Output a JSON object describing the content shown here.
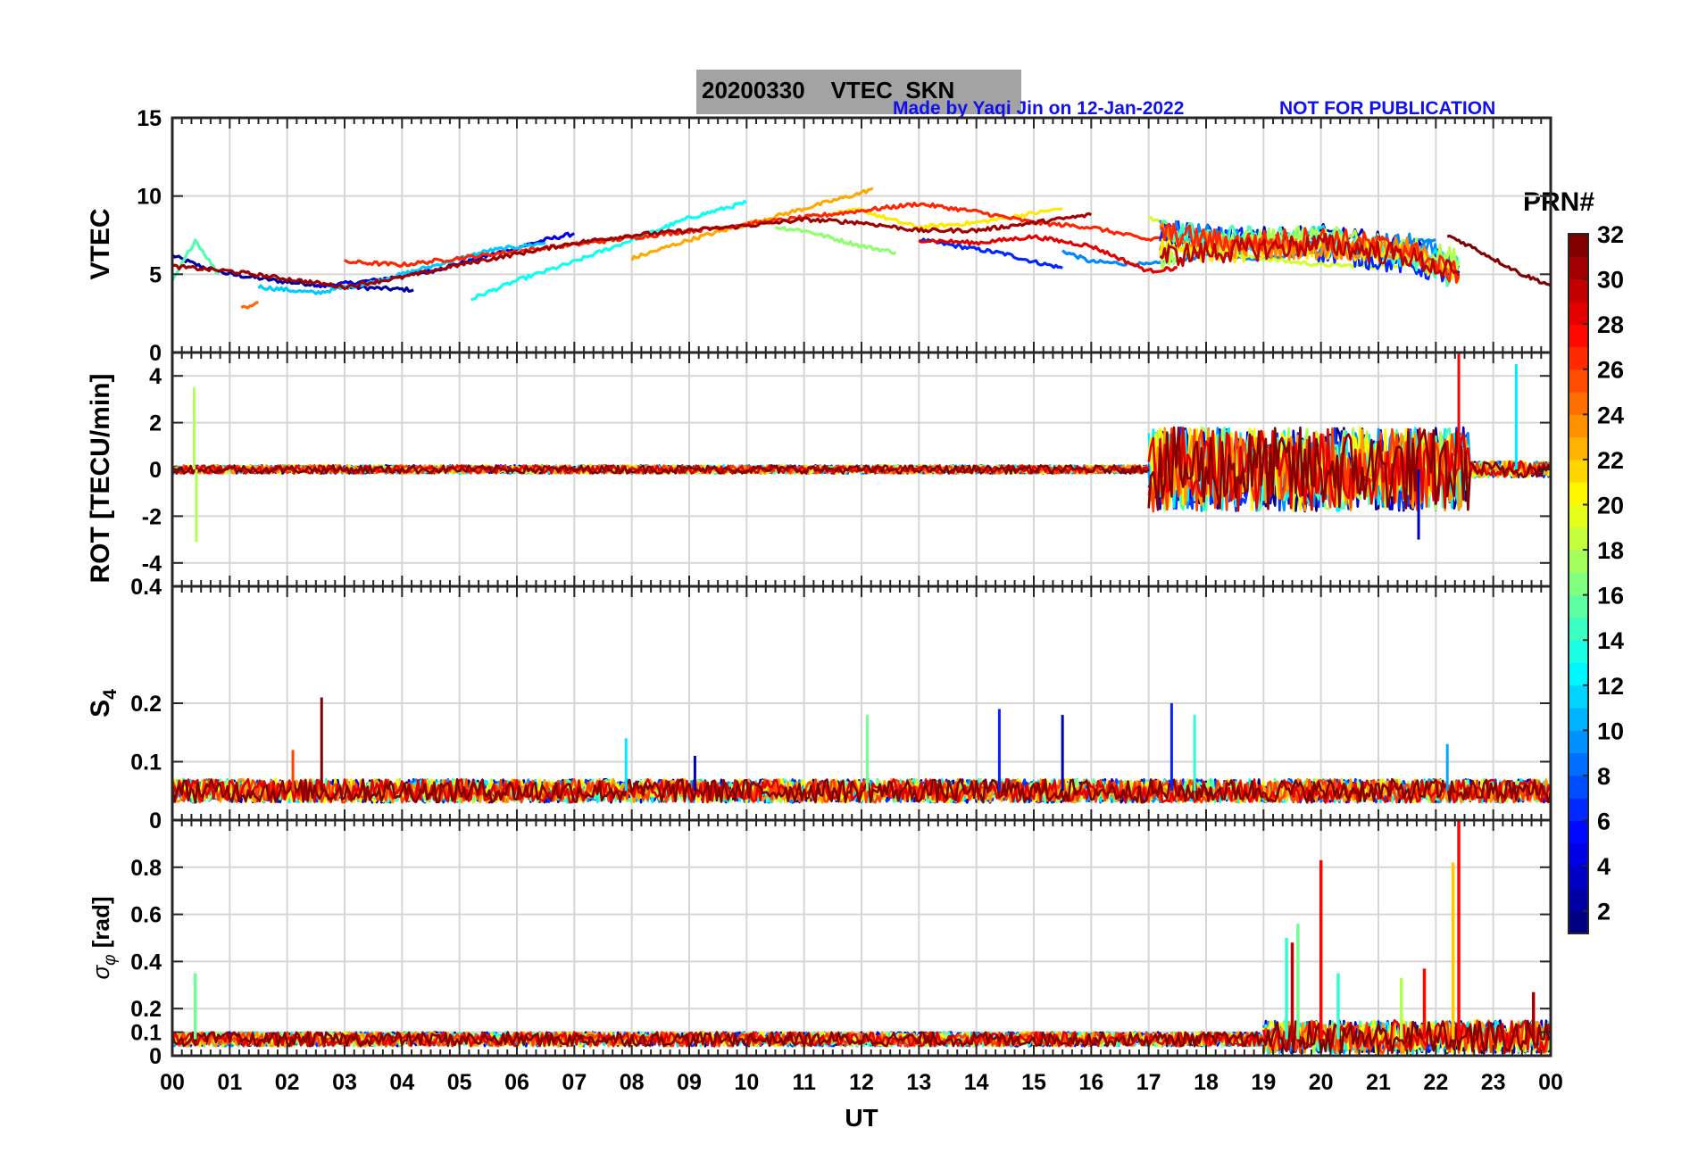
{
  "header": {
    "title": "20200330    VTEC  SKN",
    "credit": "Made by Yaqi Jin on 12-Jan-2022",
    "notice": "NOT FOR PUBLICATION"
  },
  "colorbar": {
    "title": "PRN#",
    "ticks": [
      "2",
      "4",
      "6",
      "8",
      "10",
      "12",
      "14",
      "16",
      "18",
      "20",
      "22",
      "24",
      "26",
      "28",
      "30",
      "32"
    ],
    "min": 1,
    "max": 32,
    "colormap": "jet"
  },
  "chart_data": [
    {
      "type": "line",
      "panel": "vtec",
      "ylabel": "VTEC",
      "ylim": [
        0,
        15
      ],
      "yticks": [
        "0",
        "5",
        "10",
        "15"
      ],
      "xlim": [
        0,
        24
      ],
      "grid": true,
      "series": [
        {
          "prn": 2,
          "x": [
            0,
            0.5,
            1,
            2,
            3,
            4.2
          ],
          "y": [
            6.2,
            5.5,
            5.0,
            4.5,
            4.2,
            4.0
          ]
        },
        {
          "prn": 4,
          "x": [
            2.5,
            3.5,
            4.5,
            5.5,
            6.5,
            7
          ],
          "y": [
            4.2,
            4.6,
            5.2,
            6.2,
            7.2,
            7.6
          ]
        },
        {
          "prn": 6,
          "x": [
            13,
            14,
            14.5,
            15,
            15.5
          ],
          "y": [
            7.2,
            6.6,
            6.3,
            5.8,
            5.4
          ]
        },
        {
          "prn": 9,
          "x": [
            15.5,
            16,
            17,
            18,
            19,
            20,
            21,
            22
          ],
          "y": [
            6.5,
            5.8,
            5.6,
            6.2,
            6.0,
            6.5,
            6.8,
            7.2
          ]
        },
        {
          "prn": 11,
          "x": [
            1.5,
            2.5,
            3.5,
            4.5,
            5.5,
            6.5
          ],
          "y": [
            4.2,
            3.8,
            4.5,
            5.5,
            6.5,
            7.0
          ]
        },
        {
          "prn": 13,
          "x": [
            5.2,
            6,
            7,
            8,
            9,
            10
          ],
          "y": [
            3.4,
            4.6,
            5.8,
            7.2,
            8.6,
            9.6
          ]
        },
        {
          "prn": 15,
          "x": [
            0,
            0.4,
            0.8
          ],
          "y": [
            4.5,
            7.2,
            5.0
          ]
        },
        {
          "prn": 17,
          "x": [
            10.5,
            11,
            11.5,
            12,
            12.6
          ],
          "y": [
            8.0,
            7.8,
            7.3,
            6.8,
            6.4
          ]
        },
        {
          "prn": 19,
          "x": [
            17,
            17.5,
            18,
            19,
            20,
            21,
            22
          ],
          "y": [
            8.6,
            8.0,
            6.4,
            6.0,
            5.6,
            5.5,
            5.8
          ]
        },
        {
          "prn": 21,
          "x": [
            11.5,
            12,
            12.5,
            13,
            14,
            15,
            15.5
          ],
          "y": [
            8.9,
            9.1,
            8.5,
            8.0,
            8.3,
            8.9,
            9.2
          ]
        },
        {
          "prn": 23,
          "x": [
            8,
            9,
            10,
            11,
            12,
            12.2
          ],
          "y": [
            6.0,
            7.2,
            8.2,
            9.2,
            10.2,
            10.5
          ]
        },
        {
          "prn": 25,
          "x": [
            1.2,
            1.5
          ],
          "y": [
            2.8,
            3.2
          ]
        },
        {
          "prn": 27,
          "x": [
            3,
            4,
            13,
            14,
            15,
            16,
            17,
            17.5
          ],
          "y": [
            5.8,
            5.6,
            9.5,
            9.0,
            8.3,
            8.0,
            7.2,
            7.6
          ]
        },
        {
          "prn": 29,
          "x": [
            13,
            14,
            15,
            16,
            17,
            17.5
          ],
          "y": [
            7.2,
            7.0,
            7.4,
            6.8,
            5.2,
            5.4
          ]
        },
        {
          "prn": 31,
          "x": [
            0,
            1,
            2,
            3,
            4,
            5,
            6,
            7,
            8,
            9,
            10,
            11,
            12,
            13,
            14,
            15,
            16
          ],
          "y": [
            5.5,
            5.2,
            4.7,
            4.2,
            4.8,
            5.6,
            6.3,
            7.0,
            7.5,
            7.8,
            8.1,
            8.5,
            8.3,
            7.8,
            7.8,
            8.3,
            8.8
          ]
        },
        {
          "prn": 32,
          "x": [
            22.2,
            22.6,
            23,
            23.5,
            24
          ],
          "y": [
            7.5,
            6.8,
            6.0,
            5.0,
            4.3
          ]
        }
      ]
    },
    {
      "type": "line",
      "panel": "rot",
      "ylabel": "ROT [TECU/min]",
      "ylim": [
        -5,
        5
      ],
      "yticks": [
        "-4",
        "-2",
        "0",
        "2",
        "4"
      ],
      "xlim": [
        0,
        24
      ],
      "grid": true,
      "note": "near 0 until 17 UT; strong fluctuations up to about ±3 between 17 and 22.5 UT",
      "spikes": [
        {
          "x": 0.38,
          "y": 3.5
        },
        {
          "x": 0.42,
          "y": -3.1
        },
        {
          "x": 22.4,
          "y": 5.0
        },
        {
          "x": 23.4,
          "y": 4.5
        },
        {
          "x": 21.7,
          "y": -3.0
        }
      ]
    },
    {
      "type": "line",
      "panel": "s4",
      "ylabel": "S4",
      "ylim": [
        0,
        0.4
      ],
      "yticks": [
        "0",
        "0.1",
        "0.2",
        "0.4"
      ],
      "xlim": [
        0,
        24
      ],
      "grid": true,
      "baseline": 0.05,
      "spikes": [
        {
          "x": 2.6,
          "y": 0.21,
          "prn": 32
        },
        {
          "x": 2.1,
          "y": 0.12,
          "prn": 26
        },
        {
          "x": 7.9,
          "y": 0.14,
          "prn": 12
        },
        {
          "x": 9.1,
          "y": 0.11,
          "prn": 3
        },
        {
          "x": 12.1,
          "y": 0.18,
          "prn": 16
        },
        {
          "x": 14.4,
          "y": 0.19,
          "prn": 6
        },
        {
          "x": 15.5,
          "y": 0.18,
          "prn": 3
        },
        {
          "x": 17.4,
          "y": 0.2,
          "prn": 6
        },
        {
          "x": 17.8,
          "y": 0.18,
          "prn": 14
        },
        {
          "x": 22.2,
          "y": 0.13,
          "prn": 10
        }
      ]
    },
    {
      "type": "line",
      "panel": "sigma",
      "ylabel": "σ_φ [rad]",
      "ylim": [
        0,
        1
      ],
      "yticks": [
        "0",
        "0.1",
        "0.2",
        "0.4",
        "0.6",
        "0.8"
      ],
      "xlim": [
        0,
        24
      ],
      "xlabel": "UT",
      "xticks": [
        "00",
        "01",
        "02",
        "03",
        "04",
        "05",
        "06",
        "07",
        "08",
        "09",
        "10",
        "11",
        "12",
        "13",
        "14",
        "15",
        "16",
        "17",
        "18",
        "19",
        "20",
        "21",
        "22",
        "23",
        "00"
      ],
      "grid": true,
      "baseline": 0.06,
      "spikes": [
        {
          "x": 0.4,
          "y": 0.35,
          "prn": 16
        },
        {
          "x": 19.4,
          "y": 0.5,
          "prn": 14
        },
        {
          "x": 19.6,
          "y": 0.56,
          "prn": 16
        },
        {
          "x": 19.5,
          "y": 0.48,
          "prn": 30
        },
        {
          "x": 20.0,
          "y": 0.83,
          "prn": 28
        },
        {
          "x": 20.3,
          "y": 0.35,
          "prn": 14
        },
        {
          "x": 21.4,
          "y": 0.33,
          "prn": 18
        },
        {
          "x": 21.8,
          "y": 0.37,
          "prn": 28
        },
        {
          "x": 22.3,
          "y": 0.82,
          "prn": 22
        },
        {
          "x": 22.4,
          "y": 1.0,
          "prn": 28
        },
        {
          "x": 23.7,
          "y": 0.27,
          "prn": 31
        }
      ]
    }
  ]
}
